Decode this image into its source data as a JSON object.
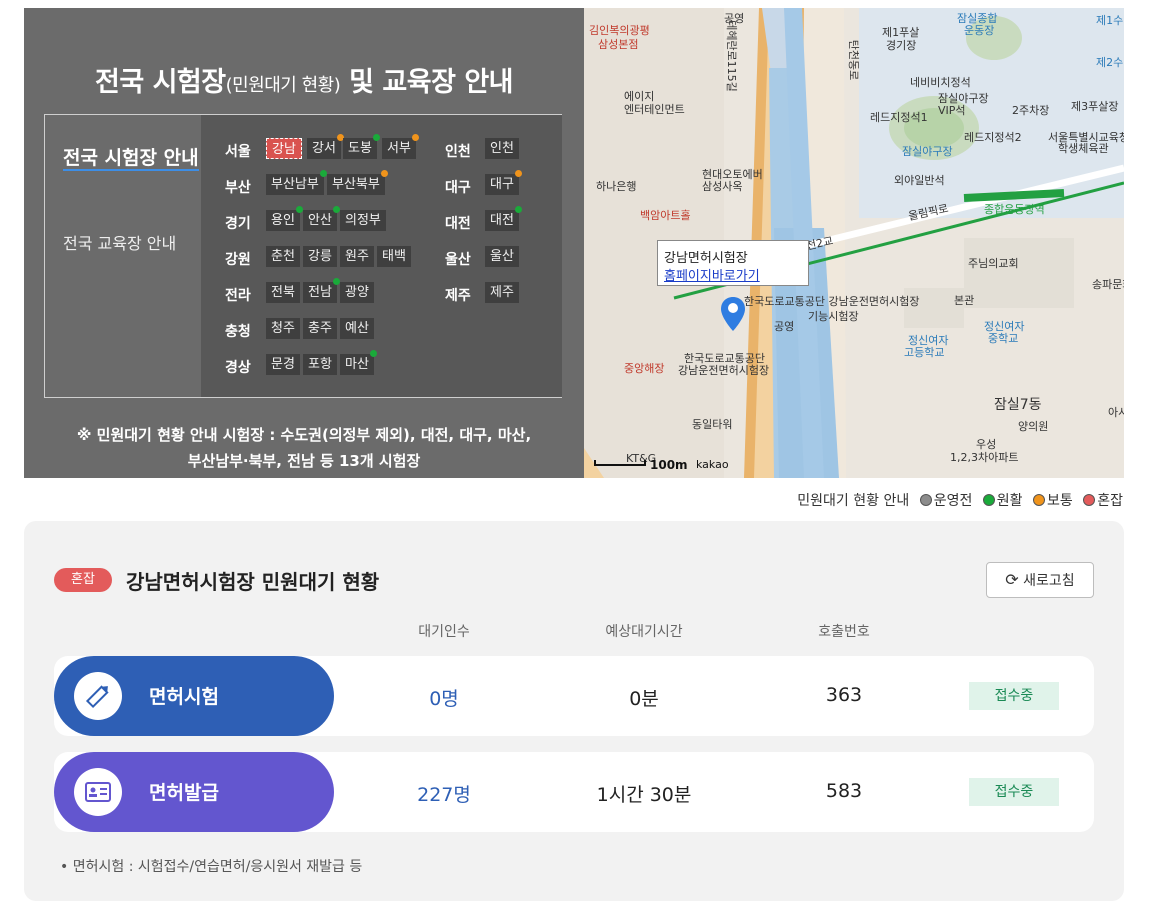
{
  "panel": {
    "title_main": "전국 시험장",
    "title_sub": "(민원대기 현황)",
    "title_tail": "및 교육장 안내",
    "nav_exam": "전국 시험장 안내",
    "nav_edu": "전국 교육장 안내",
    "regions": [
      {
        "name": "서울",
        "chips": [
          "강남",
          "강서",
          "도봉",
          "서부"
        ]
      },
      {
        "name": "부산",
        "chips": [
          "부산남부",
          "부산북부"
        ]
      },
      {
        "name": "경기",
        "chips": [
          "용인",
          "안산",
          "의정부"
        ]
      },
      {
        "name": "강원",
        "chips": [
          "춘천",
          "강릉",
          "원주",
          "태백"
        ]
      },
      {
        "name": "전라",
        "chips": [
          "전북",
          "전남",
          "광양"
        ]
      },
      {
        "name": "충청",
        "chips": [
          "청주",
          "충주",
          "예산"
        ]
      },
      {
        "name": "경상",
        "chips": [
          "문경",
          "포항",
          "마산"
        ]
      },
      {
        "name": "인천",
        "chips": [
          "인천"
        ]
      },
      {
        "name": "대구",
        "chips": [
          "대구"
        ]
      },
      {
        "name": "대전",
        "chips": [
          "대전"
        ]
      },
      {
        "name": "울산",
        "chips": [
          "울산"
        ]
      },
      {
        "name": "제주",
        "chips": [
          "제주"
        ]
      }
    ],
    "note_line1": "※ 민원대기 현황 안내 시험장 : 수도권(의정부 제외), 대전, 대구, 마산,",
    "note_line2": "부산남부·북부, 전남 등 13개 시험장"
  },
  "map": {
    "popup_title": "강남면허시험장",
    "popup_link": "홈페이지바로가기",
    "scale": "100m",
    "brand": "kakao",
    "labels": [
      "김인복의광평",
      "삼성본점",
      "공영",
      "테헤란로115길",
      "탄천동로",
      "제1푸살",
      "경기장",
      "잠실종합",
      "운동장",
      "제1수",
      "제2수",
      "에이지",
      "엔터테인먼트",
      "네비비치정석",
      "잠실야구장",
      "VIP석",
      "2주차장",
      "제3푸살장",
      "레드지정석1",
      "레드지정석2",
      "서울특별시교육청",
      "학생체육관",
      "잠실야구장",
      "현대오토에버",
      "삼성사옥",
      "하나은행",
      "외야일반석",
      "백암아트홀",
      "올림픽로",
      "종합운동장역",
      "탄천2교",
      "주님의교회",
      "강남면허시험장",
      "한국도로교통공단 강남운전면허시험장",
      "기능시험장",
      "본관",
      "공영",
      "정신여자",
      "고등학교",
      "정신여자",
      "중학교",
      "한국도로교통공단",
      "강남운전면허시험장",
      "중앙해장",
      "동일타워",
      "잠실7동",
      "양의원",
      "우성",
      "1,2,3차아파트",
      "KT&G",
      "송파문화",
      "아시"
    ]
  },
  "legend": {
    "label": "민원대기 현황 안내",
    "items": [
      "운영전",
      "원활",
      "보통",
      "혼잡"
    ]
  },
  "status": {
    "badge": "혼잡",
    "title": "강남면허시험장 민원대기 현황",
    "refresh": "새로고침",
    "col_wait": "대기인수",
    "col_time": "예상대기시간",
    "col_call": "호출번호",
    "rows": [
      {
        "label": "면허시험",
        "wait": "0명",
        "time": "0분",
        "call": "363",
        "state": "접수중"
      },
      {
        "label": "면허발급",
        "wait": "227명",
        "time": "1시간 30분",
        "call": "583",
        "state": "접수중"
      }
    ],
    "footnote": "면허시험 : 시험접수/연습면허/응시원서 재발급 등"
  },
  "colors": {
    "panel": "#6b6b6b",
    "congested": "#e35b5b",
    "exam_pill": "#2e5fb5",
    "issue_pill": "#6356cf"
  }
}
